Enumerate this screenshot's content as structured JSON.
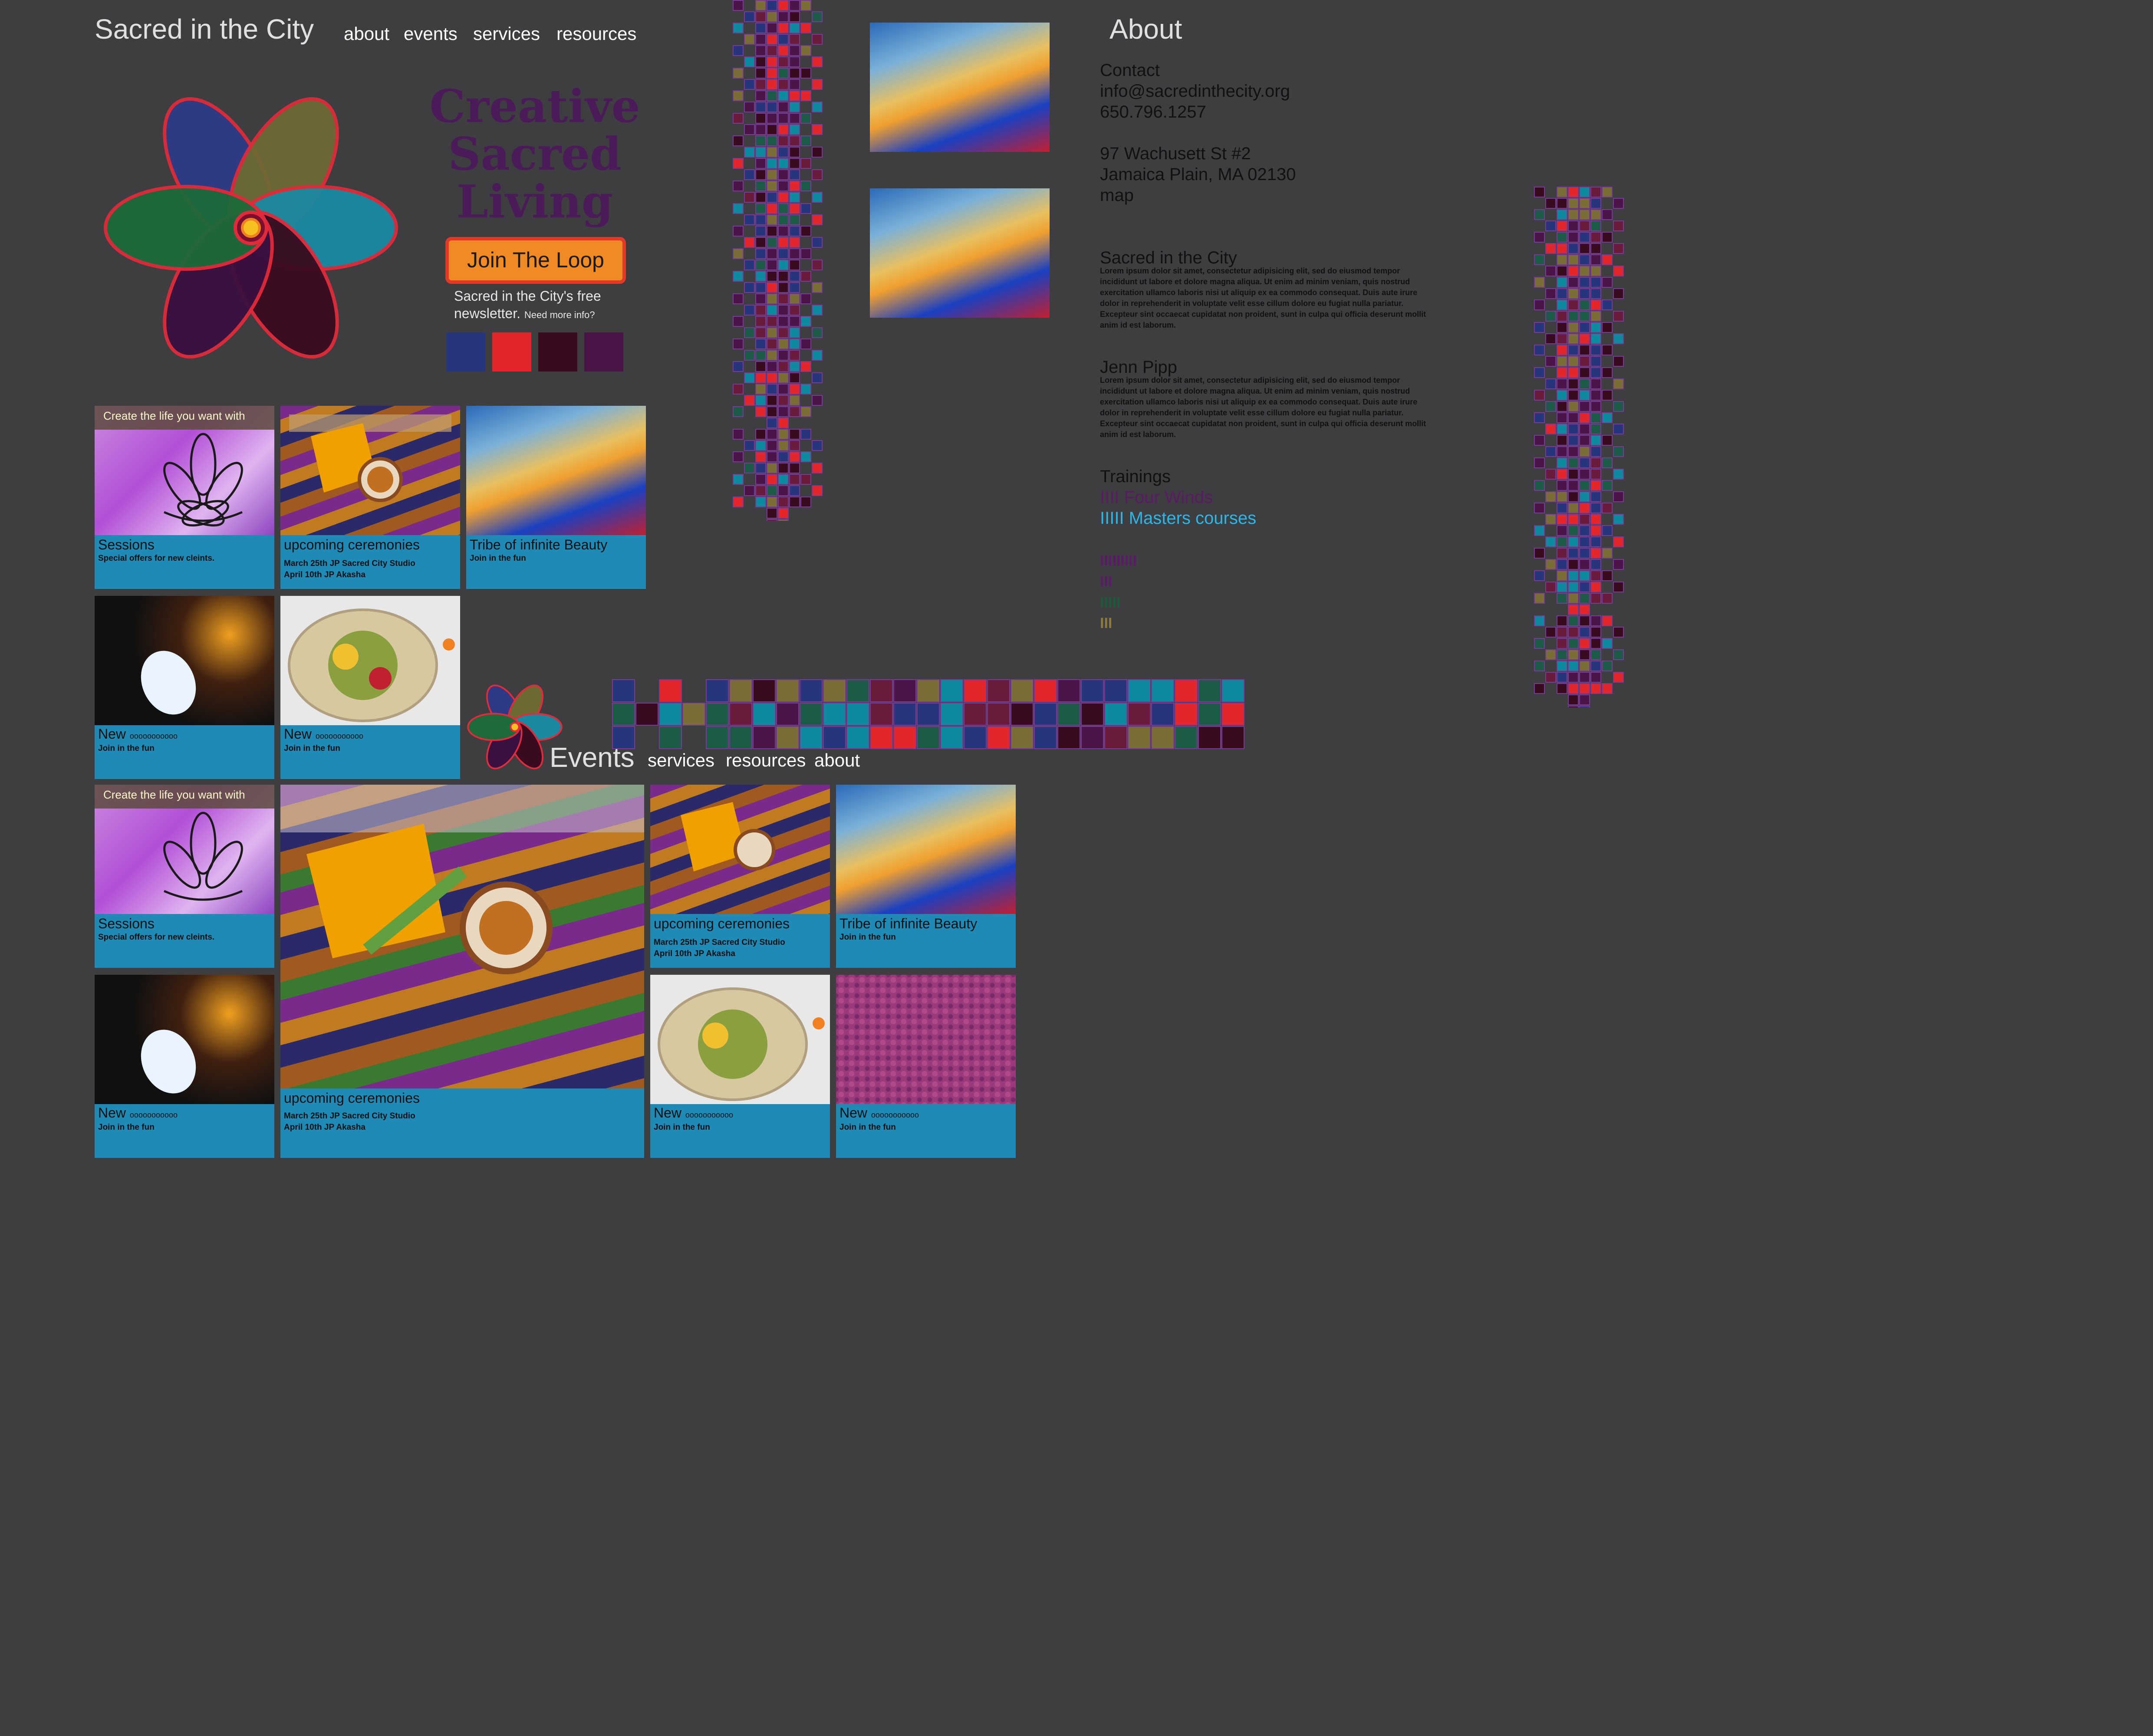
{
  "site": {
    "title": "Sacred in the City"
  },
  "nav": {
    "items": [
      "about",
      "events",
      "services",
      "resources"
    ]
  },
  "hero": {
    "tagline": [
      "Creative",
      "Sacred",
      "Living"
    ],
    "cta_label": "Join The Loop",
    "newsletter_text": "Sacred in the City's free",
    "newsletter_text2": "newsletter.",
    "need_info": "Need more info?",
    "swatches": [
      "#27367c",
      "#e3262c",
      "#3a0b1f",
      "#4a1446"
    ]
  },
  "cards": {
    "sessions": {
      "title": "Sessions",
      "sub": "Special offers for new cleints.",
      "img_text": "Create the life you want with"
    },
    "ceremonies": {
      "title": "upcoming ceremonies",
      "line1": "March 25th JP Sacred City Studio",
      "line2": "April 10th JP Akasha"
    },
    "tribe": {
      "title": "Tribe of infinite Beauty",
      "sub": "Join in the fun"
    },
    "new1": {
      "title": "New",
      "title_tail": "ooooooooooo",
      "sub": "Join in the fun"
    },
    "new2": {
      "title": "New",
      "title_tail": "ooooooooooo",
      "sub": "Join in the fun"
    }
  },
  "events_page": {
    "title": "Events",
    "nav": [
      "services",
      "resources",
      "about"
    ],
    "cards": {
      "sessions": {
        "title": "Sessions",
        "sub": "Special offers for new cleints.",
        "img_text": "Create the life you want with"
      },
      "big": {
        "title": "upcoming ceremonies",
        "line1": "March 25th JP Sacred City Studio",
        "line2": "April 10th JP Akasha"
      },
      "ceremonies": {
        "title": "upcoming ceremonies",
        "line1": "March 25th JP Sacred City Studio",
        "line2": "April 10th JP Akasha"
      },
      "tribe": {
        "title": "Tribe of infinite Beauty",
        "sub": "Join in the fun"
      },
      "new1": {
        "title": "New",
        "title_tail": "ooooooooooo",
        "sub": "Join in the fun"
      },
      "new2": {
        "title": "New",
        "title_tail": "ooooooooooo",
        "sub": "Join in the fun"
      },
      "new3": {
        "title": "New",
        "title_tail": "ooooooooooo",
        "sub": "Join in the fun"
      }
    }
  },
  "about": {
    "heading": "About",
    "contact_label": "Contact",
    "email": "info@sacredinthecity.org",
    "phone": "650.796.1257",
    "address1": "97 Wachusett St #2",
    "address2": "Jamaica Plain, MA 02130",
    "map_link": "map",
    "sacred_heading": "Sacred in the City",
    "sacred_body": "Lorem ipsum dolor sit amet, consectetur adipisicing elit, sed do eiusmod tempor incididunt ut labore et dolore magna aliqua. Ut enim ad minim veniam, quis nostrud exercitation ullamco laboris nisi ut aliquip ex ea commodo consequat. Duis aute irure dolor in reprehenderit in voluptate velit esse cillum dolore eu fugiat nulla pariatur. Excepteur sint occaecat cupidatat non proident, sunt in culpa qui officia deserunt mollit anim id est laborum.",
    "jenn_heading": "Jenn Pipp",
    "jenn_body": "Lorem ipsum dolor sit amet, consectetur adipisicing elit, sed do eiusmod tempor incididunt ut labore et dolore magna aliqua. Ut enim ad minim veniam, quis nostrud exercitation ullamco laboris nisi ut aliquip ex ea commodo consequat. Duis aute irure dolor in reprehenderit in voluptate velit esse cillum dolore eu fugiat nulla pariatur. Excepteur sint occaecat cupidatat non proident, sunt in culpa qui officia deserunt mollit anim id est laborum.",
    "trainings_heading": "Trainings",
    "training1": "IIII Four Winds",
    "training2": "IIIII Masters courses",
    "bars": [
      "IIIIIIIII",
      "III",
      "IIIII",
      "III"
    ],
    "training1_color": "#5a1a66",
    "training2_color": "#2bb7e8",
    "bar_colors": [
      "#5a1a66",
      "#5a1a66",
      "#1f5a3a",
      "#8a7a40"
    ]
  },
  "palette": [
    "#27367c",
    "#e3262c",
    "#3a0b1f",
    "#4a1446",
    "#7a6e36",
    "#0e8aa0",
    "#1d5a48",
    "#6a1a3a"
  ]
}
